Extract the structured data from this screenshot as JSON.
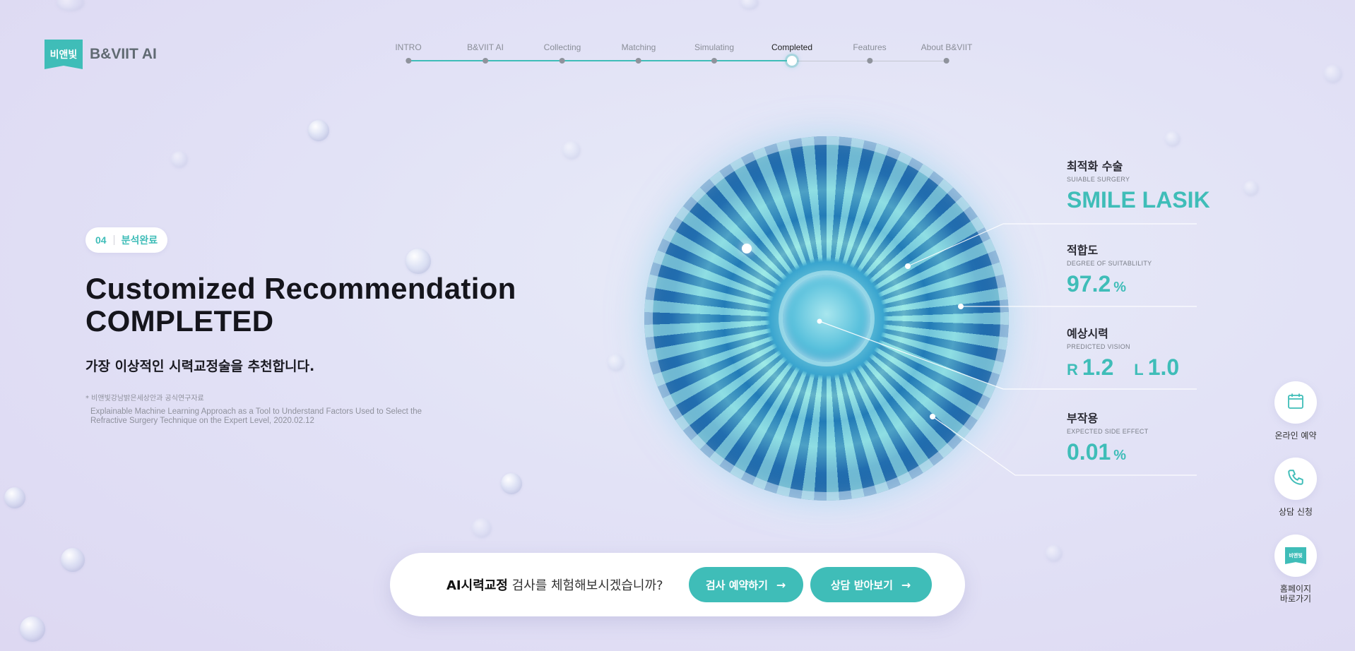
{
  "brand": {
    "mark": "비앤빛",
    "name": "B&VIIT AI",
    "accent": "#3fbdb8"
  },
  "nav": {
    "active_index": 5,
    "items": [
      {
        "label": "INTRO"
      },
      {
        "label": "B&VIIT AI"
      },
      {
        "label": "Collecting"
      },
      {
        "label": "Matching"
      },
      {
        "label": "Simulating"
      },
      {
        "label": "Completed"
      },
      {
        "label": "Features"
      },
      {
        "label": "About B&VIIT"
      }
    ]
  },
  "hero": {
    "step_num": "04",
    "step_label": "분석완료",
    "title_line1": "Customized Recommendation",
    "title_line2": "COMPLETED",
    "subtitle": "가장 이상적인 시력교정술을 추천합니다.",
    "ref_note": "* 비앤빛강남밝은세상안과 공식연구자료",
    "ref_cite": "Explainable Machine Learning Approach as a Tool to Understand Factors Used to Select the Refractive Surgery Technique on the Expert Level, 2020.02.12"
  },
  "stats": {
    "surgery": {
      "kr": "최적화 수술",
      "en": "SUIABLE SURGERY",
      "value": "SMILE LASIK"
    },
    "suitability": {
      "kr": "적합도",
      "en": "DEGREE OF SUITABLILITY",
      "value": "97.2",
      "unit": "%"
    },
    "vision": {
      "kr": "예상시력",
      "en": "PREDICTED VISION",
      "right_label": "R",
      "right_value": "1.2",
      "left_label": "L",
      "left_value": "1.0"
    },
    "side_effect": {
      "kr": "부작용",
      "en": "EXPECTED SIDE EFFECT",
      "value": "0.01",
      "unit": "%"
    }
  },
  "quick_menu": {
    "reserve": {
      "label": "온라인 예약",
      "icon": "calendar-icon"
    },
    "consult": {
      "label": "상담 신청",
      "icon": "phone-icon"
    },
    "home": {
      "label_line1": "홈페이지",
      "label_line2": "바로가기",
      "icon": "bnviit-logo-icon",
      "mark": "비앤빛"
    }
  },
  "cta": {
    "strong": "AI시력교정",
    "text": " 검사를 체험해보시겠습니까?",
    "btn_exam": "검사 예약하기",
    "btn_consult": "상담 받아보기",
    "arrow": "→"
  }
}
